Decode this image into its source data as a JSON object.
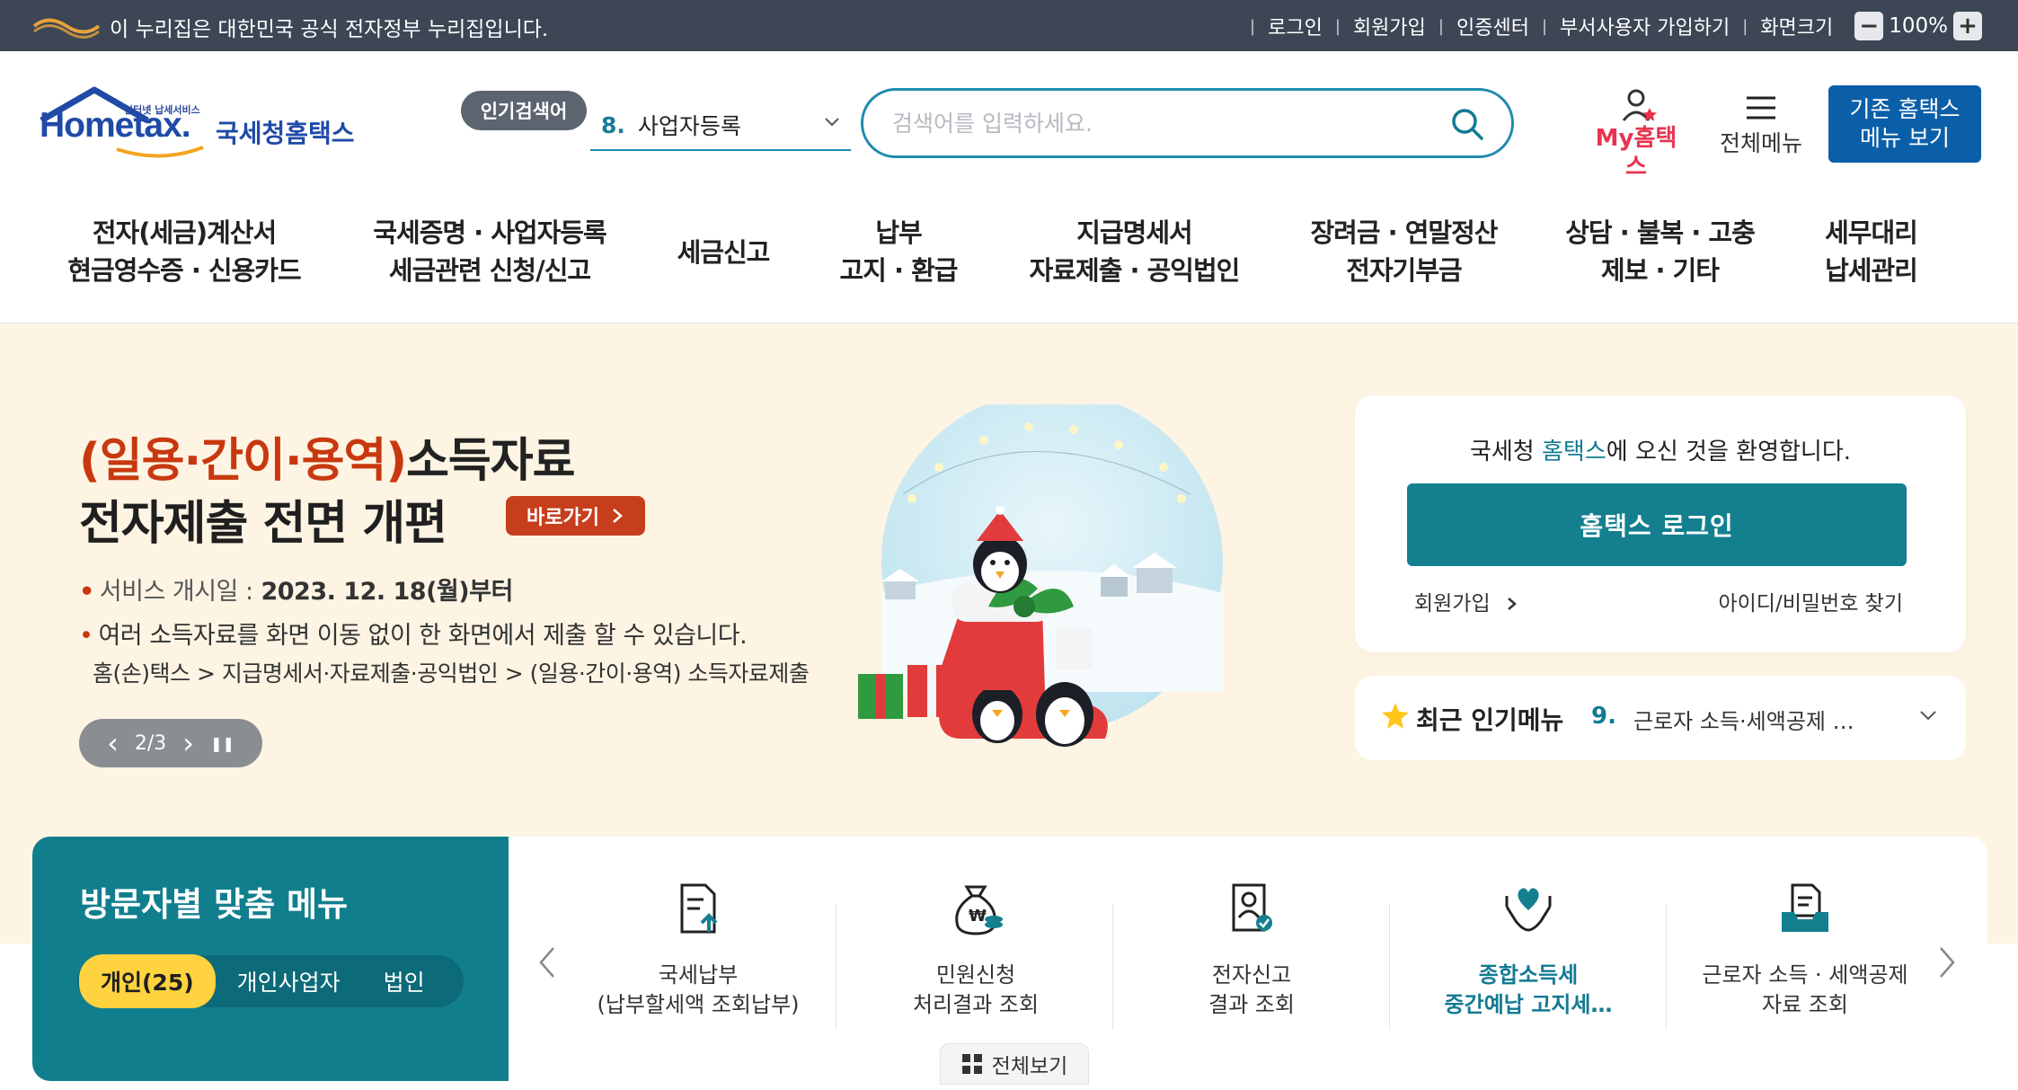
{
  "gov_bar": {
    "text": "이 누리집은 대한민국 공식 전자정부 누리집입니다.",
    "links": [
      "로그인",
      "회원가입",
      "인증센터",
      "부서사용자 가입하기",
      "화면크기"
    ],
    "zoom_minus": "−",
    "zoom_value": "100%",
    "zoom_plus": "+"
  },
  "header": {
    "logo_sub": "인터넷 납세서비스",
    "logo_en": "Hometax.",
    "logo_ko": "국세청홈택스",
    "popular_badge": "인기검색어",
    "popular_num": "8.",
    "popular_term": "사업자등록",
    "search_placeholder": "검색어를 입력하세요.",
    "my_hometax": "My홈택스",
    "all_menu": "전체메뉴",
    "legacy_menu_line1": "기존 홈택스",
    "legacy_menu_line2": "메뉴 보기"
  },
  "gnb": [
    {
      "line1": "전자(세금)계산서",
      "line2": "현금영수증 · 신용카드"
    },
    {
      "line1": "국세증명 · 사업자등록",
      "line2": "세금관련 신청/신고"
    },
    {
      "line1": "세금신고",
      "line2": ""
    },
    {
      "line1": "납부",
      "line2": "고지 · 환급"
    },
    {
      "line1": "지급명세서",
      "line2": "자료제출 · 공익법인"
    },
    {
      "line1": "장려금 · 연말정산",
      "line2": "전자기부금"
    },
    {
      "line1": "상담 · 불복 · 고충",
      "line2": "제보 · 기타"
    },
    {
      "line1": "세무대리",
      "line2": "납세관리"
    }
  ],
  "banner": {
    "title_red": "(일용·간이·용역)",
    "title_black": "소득자료",
    "title2": "전자제출 전면 개편",
    "go_label": "바로가기",
    "line1_label": "서비스 개시일 :",
    "line1_value": "2023. 12. 18(월)부터",
    "line2": "여러 소득자료를 화면 이동 없이 한 화면에서 제출 할 수 있습니다.",
    "line3": "홈(손)택스 > 지급명세서·자료제출·공익법인 > (일용·간이·용역) 소득자료제출",
    "slide_indicator": "2/3",
    "prev": "‹",
    "next": "›",
    "pause": "❚❚"
  },
  "login_card": {
    "welcome_pre": "국세청 ",
    "welcome_brand": "홈택스",
    "welcome_post": "에 오신 것을 환영합니다.",
    "login_button": "홈택스 로그인",
    "signup": "회원가입",
    "find_account": "아이디/비밀번호 찾기"
  },
  "recent_menu": {
    "title": "최근 인기메뉴",
    "num": "9.",
    "item": "근로자 소득·세액공제 …"
  },
  "visitor_menu": {
    "title": "방문자별 맞춤 메뉴",
    "tabs": [
      "개인(25)",
      "개인사업자",
      "법인"
    ],
    "items": [
      {
        "line1": "국세납부",
        "line2": "(납부할세액 조회납부)"
      },
      {
        "line1": "민원신청",
        "line2": "처리결과 조회"
      },
      {
        "line1": "전자신고",
        "line2": "결과 조회"
      },
      {
        "line1": "종합소득세",
        "line2": "중간예납 고지세…"
      },
      {
        "line1": "근로자 소득 · 세액공제",
        "line2": "자료 조회"
      }
    ],
    "view_all": "전체보기"
  },
  "colors": {
    "teal": "#14808f",
    "brand_blue": "#1f4aa8",
    "accent_red": "#c8380f",
    "highlight_yellow": "#ffd23f",
    "banner_bg": "#fdf4e3"
  }
}
